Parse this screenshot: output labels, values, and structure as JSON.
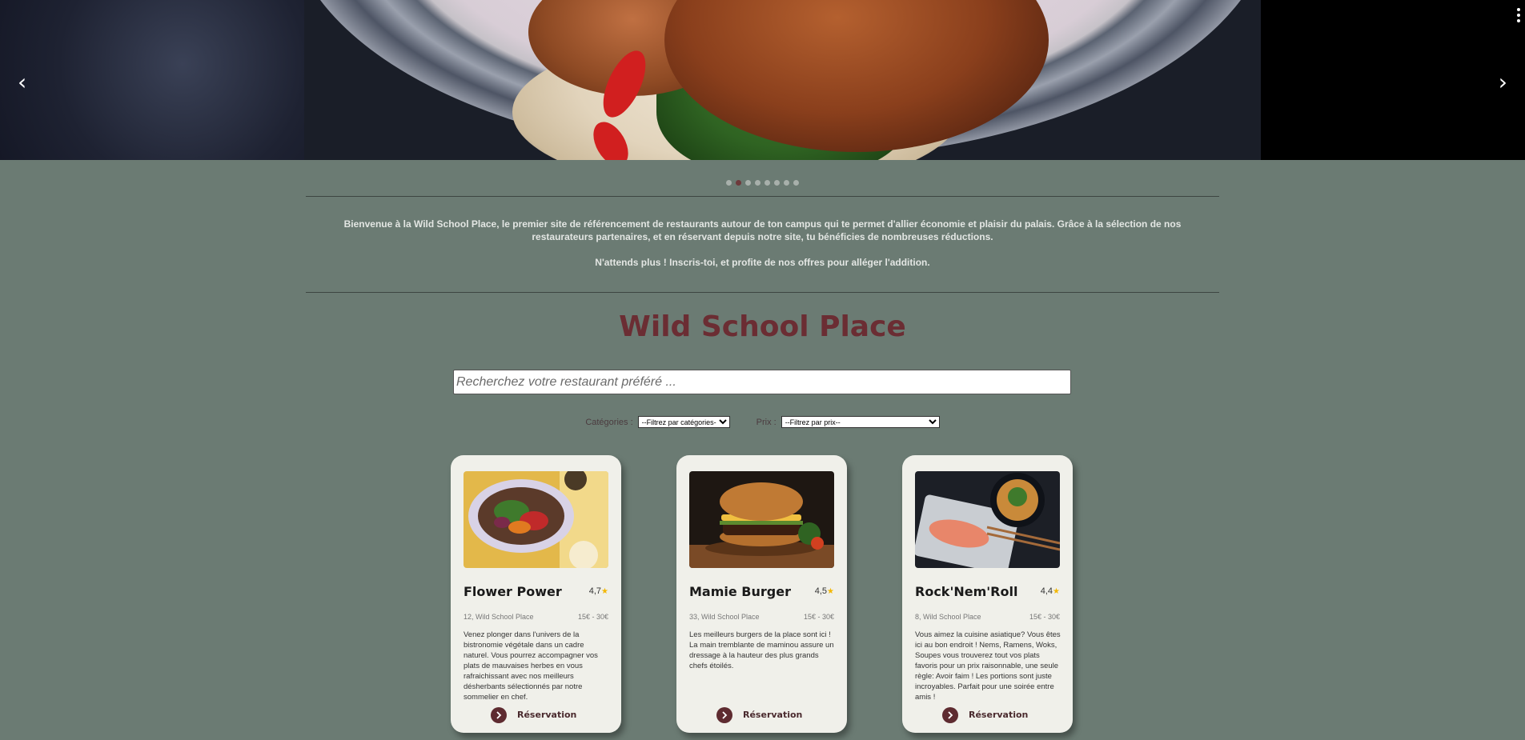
{
  "hero": {
    "prev_arrow": "‹",
    "next_arrow": "›",
    "slide_count": 8,
    "active_slide": 2
  },
  "intro": {
    "paragraph1": "Bienvenue à la Wild School Place, le premier site de référencement de restaurants autour de ton campus qui te permet d'allier économie et plaisir du palais. Grâce à la sélection de nos restaurateurs partenaires, et en réservant depuis notre site, tu bénéficies de nombreuses réductions.",
    "paragraph2": "N'attends plus ! Inscris-toi, et profite de nos offres pour alléger l'addition."
  },
  "site_title": "Wild School Place",
  "search": {
    "placeholder": "Recherchez votre restaurant préféré ...",
    "value": ""
  },
  "filters": {
    "categories_label": "Catégories :",
    "categories_selected": "--Filtrez par catégories--",
    "price_label": "Prix :",
    "price_selected": "--Filtrez par prix--"
  },
  "restaurants": [
    {
      "name": "Flower Power",
      "rating": "4,7",
      "address": "12, Wild School Place",
      "price": "15€ - 30€",
      "description": "Venez plonger dans l'univers de la bistronomie végétale dans un cadre naturel. Vous pourrez accompagner vos plats de mauvaises herbes en vous rafraichissant avec nos meilleurs désherbants sélectionnés par notre sommelier en chef.",
      "button": "Réservation",
      "image": "salad-bowl-image"
    },
    {
      "name": "Mamie Burger",
      "rating": "4,5",
      "address": "33, Wild School Place",
      "price": "15€ - 30€",
      "description": "Les meilleurs burgers de la place sont ici ! La main tremblante de maminou assure un dressage à la hauteur des plus grands chefs étoilés.",
      "button": "Réservation",
      "image": "burger-image"
    },
    {
      "name": "Rock'Nem'Roll",
      "rating": "4,4",
      "address": "8, Wild School Place",
      "price": "15€ - 30€",
      "description": "Vous aimez la cuisine asiatique? Vous êtes ici au bon endroit ! Nems, Ramens, Woks, Soupes vous trouverez tout vos plats favoris pour un prix raisonnable, une seule règle: Avoir faim ! Les portions sont juste incroyables. Parfait pour une soirée entre amis !",
      "button": "Réservation",
      "image": "asian-dish-image"
    }
  ],
  "star_glyph": "★",
  "colors": {
    "background": "#6b7b73",
    "title": "#6b2d33",
    "card": "#f0f0ea",
    "button_icon": "#5e2b30",
    "star": "#f3b700"
  }
}
